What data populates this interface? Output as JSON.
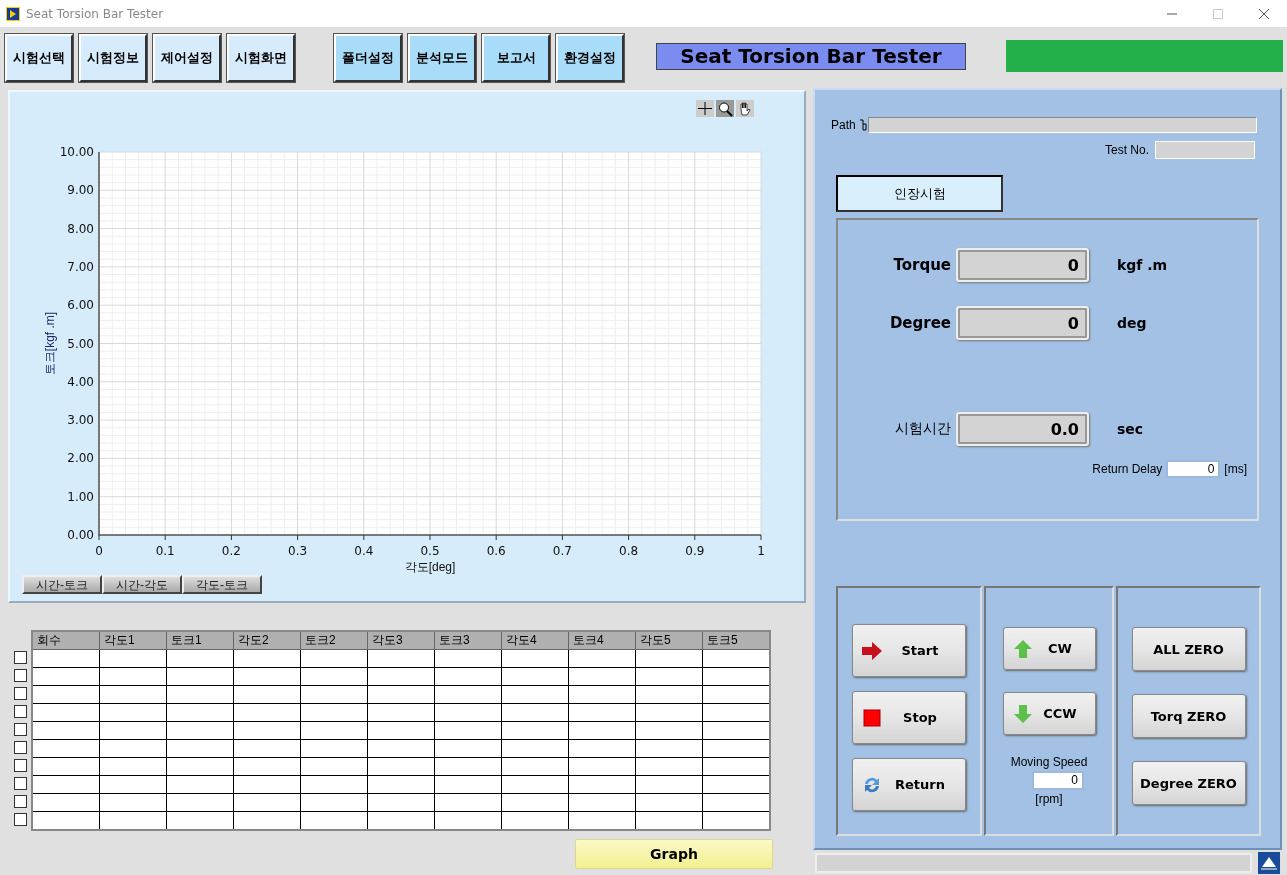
{
  "window": {
    "title": "Seat Torsion Bar Tester"
  },
  "toolbar": {
    "buttons": [
      "시험선택",
      "시험정보",
      "제어설정",
      "시험화면",
      "폴더설정",
      "분석모드",
      "보고서",
      "환경설정"
    ],
    "banner": "Seat Torsion Bar Tester"
  },
  "graph": {
    "chart_data": {
      "type": "line",
      "grid": true,
      "xlabel": "각도[deg]",
      "ylabel": "토크[kgf .m]",
      "xlim": [
        0,
        1
      ],
      "ylim": [
        0,
        10
      ],
      "xticks": [
        {
          "value": 0,
          "label": "0"
        },
        {
          "value": 0.1,
          "label": "0.1"
        },
        {
          "value": 0.2,
          "label": "0.2"
        },
        {
          "value": 0.3,
          "label": "0.3"
        },
        {
          "value": 0.4,
          "label": "0.4"
        },
        {
          "value": 0.5,
          "label": "0.5"
        },
        {
          "value": 0.6,
          "label": "0.6"
        },
        {
          "value": 0.7,
          "label": "0.7"
        },
        {
          "value": 0.8,
          "label": "0.8"
        },
        {
          "value": 0.9,
          "label": "0.9"
        },
        {
          "value": 1,
          "label": "1"
        }
      ],
      "yticks": [
        {
          "value": 0,
          "label": "0.00"
        },
        {
          "value": 1,
          "label": "1.00"
        },
        {
          "value": 2,
          "label": "2.00"
        },
        {
          "value": 3,
          "label": "3.00"
        },
        {
          "value": 4,
          "label": "4.00"
        },
        {
          "value": 5,
          "label": "5.00"
        },
        {
          "value": 6,
          "label": "6.00"
        },
        {
          "value": 7,
          "label": "7.00"
        },
        {
          "value": 8,
          "label": "8.00"
        },
        {
          "value": 9,
          "label": "9.00"
        },
        {
          "value": 10,
          "label": "10.00"
        }
      ]
    },
    "plot_buttons": [
      "시간-토크",
      "시간-각도",
      "각도-토크"
    ]
  },
  "table": {
    "columns": [
      "회수",
      "각도1",
      "토크1",
      "각도2",
      "토크2",
      "각도3",
      "토크3",
      "각도4",
      "토크4",
      "각도5",
      "토크5"
    ],
    "rows": [
      {
        "checked": false
      },
      {
        "checked": false
      },
      {
        "checked": false
      },
      {
        "checked": false
      },
      {
        "checked": false
      },
      {
        "checked": false
      },
      {
        "checked": false
      },
      {
        "checked": false
      },
      {
        "checked": false
      },
      {
        "checked": false
      }
    ]
  },
  "graph_button": "Graph",
  "right_panel": {
    "path_label": "Path",
    "test_no_label": "Test No.",
    "mode_button": "인장시험",
    "readouts": [
      {
        "label": "Torque",
        "value": "0",
        "unit": "kgf .m"
      },
      {
        "label": "Degree",
        "value": "0",
        "unit": "deg"
      },
      {
        "label": "시험시간",
        "value": "0.0",
        "unit": "sec"
      }
    ],
    "return_delay": {
      "label": "Return Delay",
      "value": "0",
      "unit": "[ms]"
    },
    "run_buttons": [
      {
        "kind": "start",
        "label": "Start"
      },
      {
        "kind": "stop",
        "label": "Stop"
      },
      {
        "kind": "return",
        "label": "Return"
      }
    ],
    "jog_buttons": [
      {
        "kind": "up",
        "label": "CW"
      },
      {
        "kind": "down",
        "label": "CCW"
      }
    ],
    "moving_speed": {
      "label": "Moving Speed",
      "value": "0",
      "unit": "[rpm]"
    },
    "zero_buttons": [
      "ALL ZERO",
      "Torq ZERO",
      "Degree ZERO"
    ]
  }
}
